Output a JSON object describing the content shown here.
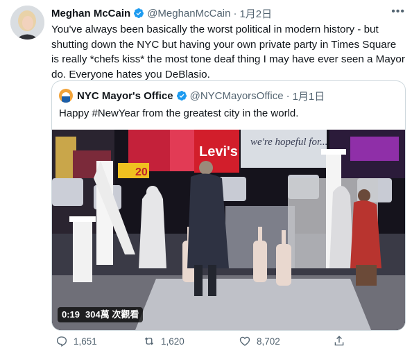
{
  "tweet": {
    "author_name": "Meghan McCain",
    "author_handle": "@MeghanMcCain",
    "separator": "·",
    "date": "1月2日",
    "text": "You've always been basically the worst political in modern history - but shutting down the NYC but having your own private party in Times Square is really *chefs kiss* the most tone deaf thing I may have ever seen a Mayor do. Everyone hates you DeBlasio."
  },
  "quoted_tweet": {
    "author_name": "NYC Mayor's Office",
    "author_handle": "@NYCMayorsOffice",
    "separator": "·",
    "date": "1月1日",
    "text": "Happy #NewYear from the greatest city in the world.",
    "video": {
      "duration": "0:19",
      "views": "304萬 次觀看",
      "billboard_brand": "Levi's",
      "billboard_message": "we're hopeful for...",
      "sign_number": "20"
    }
  },
  "actions": {
    "reply_count": "1,651",
    "retweet_count": "1,620",
    "like_count": "8,702"
  },
  "icons": {
    "verified": "verified-badge-icon",
    "more": "more-options-icon",
    "reply": "reply-icon",
    "retweet": "retweet-icon",
    "like": "heart-icon",
    "share": "share-icon"
  },
  "colors": {
    "verified_blue": "#1d9bf0",
    "text": "#0f1419",
    "muted": "#536471",
    "border": "#cfd9de"
  }
}
